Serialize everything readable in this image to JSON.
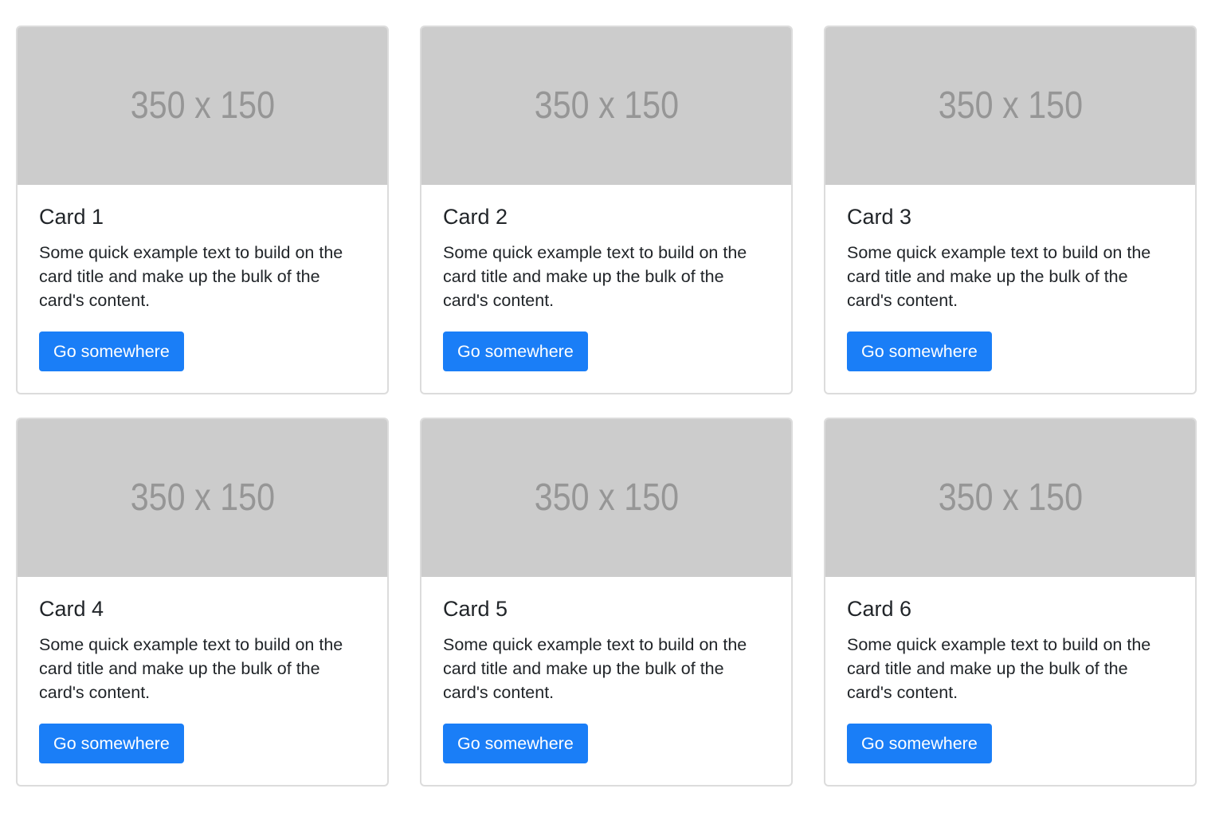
{
  "cards": [
    {
      "image_label": "350 x 150",
      "title": "Card 1",
      "text": "Some quick example text to build on the card title and make up the bulk of the card's content.",
      "button_label": "Go somewhere"
    },
    {
      "image_label": "350 x 150",
      "title": "Card 2",
      "text": "Some quick example text to build on the card title and make up the bulk of the card's content.",
      "button_label": "Go somewhere"
    },
    {
      "image_label": "350 x 150",
      "title": "Card 3",
      "text": "Some quick example text to build on the card title and make up the bulk of the card's content.",
      "button_label": "Go somewhere"
    },
    {
      "image_label": "350 x 150",
      "title": "Card 4",
      "text": "Some quick example text to build on the card title and make up the bulk of the card's content.",
      "button_label": "Go somewhere"
    },
    {
      "image_label": "350 x 150",
      "title": "Card 5",
      "text": "Some quick example text to build on the card title and make up the bulk of the card's content.",
      "button_label": "Go somewhere"
    },
    {
      "image_label": "350 x 150",
      "title": "Card 6",
      "text": "Some quick example text to build on the card title and make up the bulk of the card's content.",
      "button_label": "Go somewhere"
    }
  ],
  "colors": {
    "button_bg": "#1a7ef7",
    "placeholder_bg": "#cccccc",
    "placeholder_text": "#969696",
    "card_border": "#dcdcdc"
  }
}
